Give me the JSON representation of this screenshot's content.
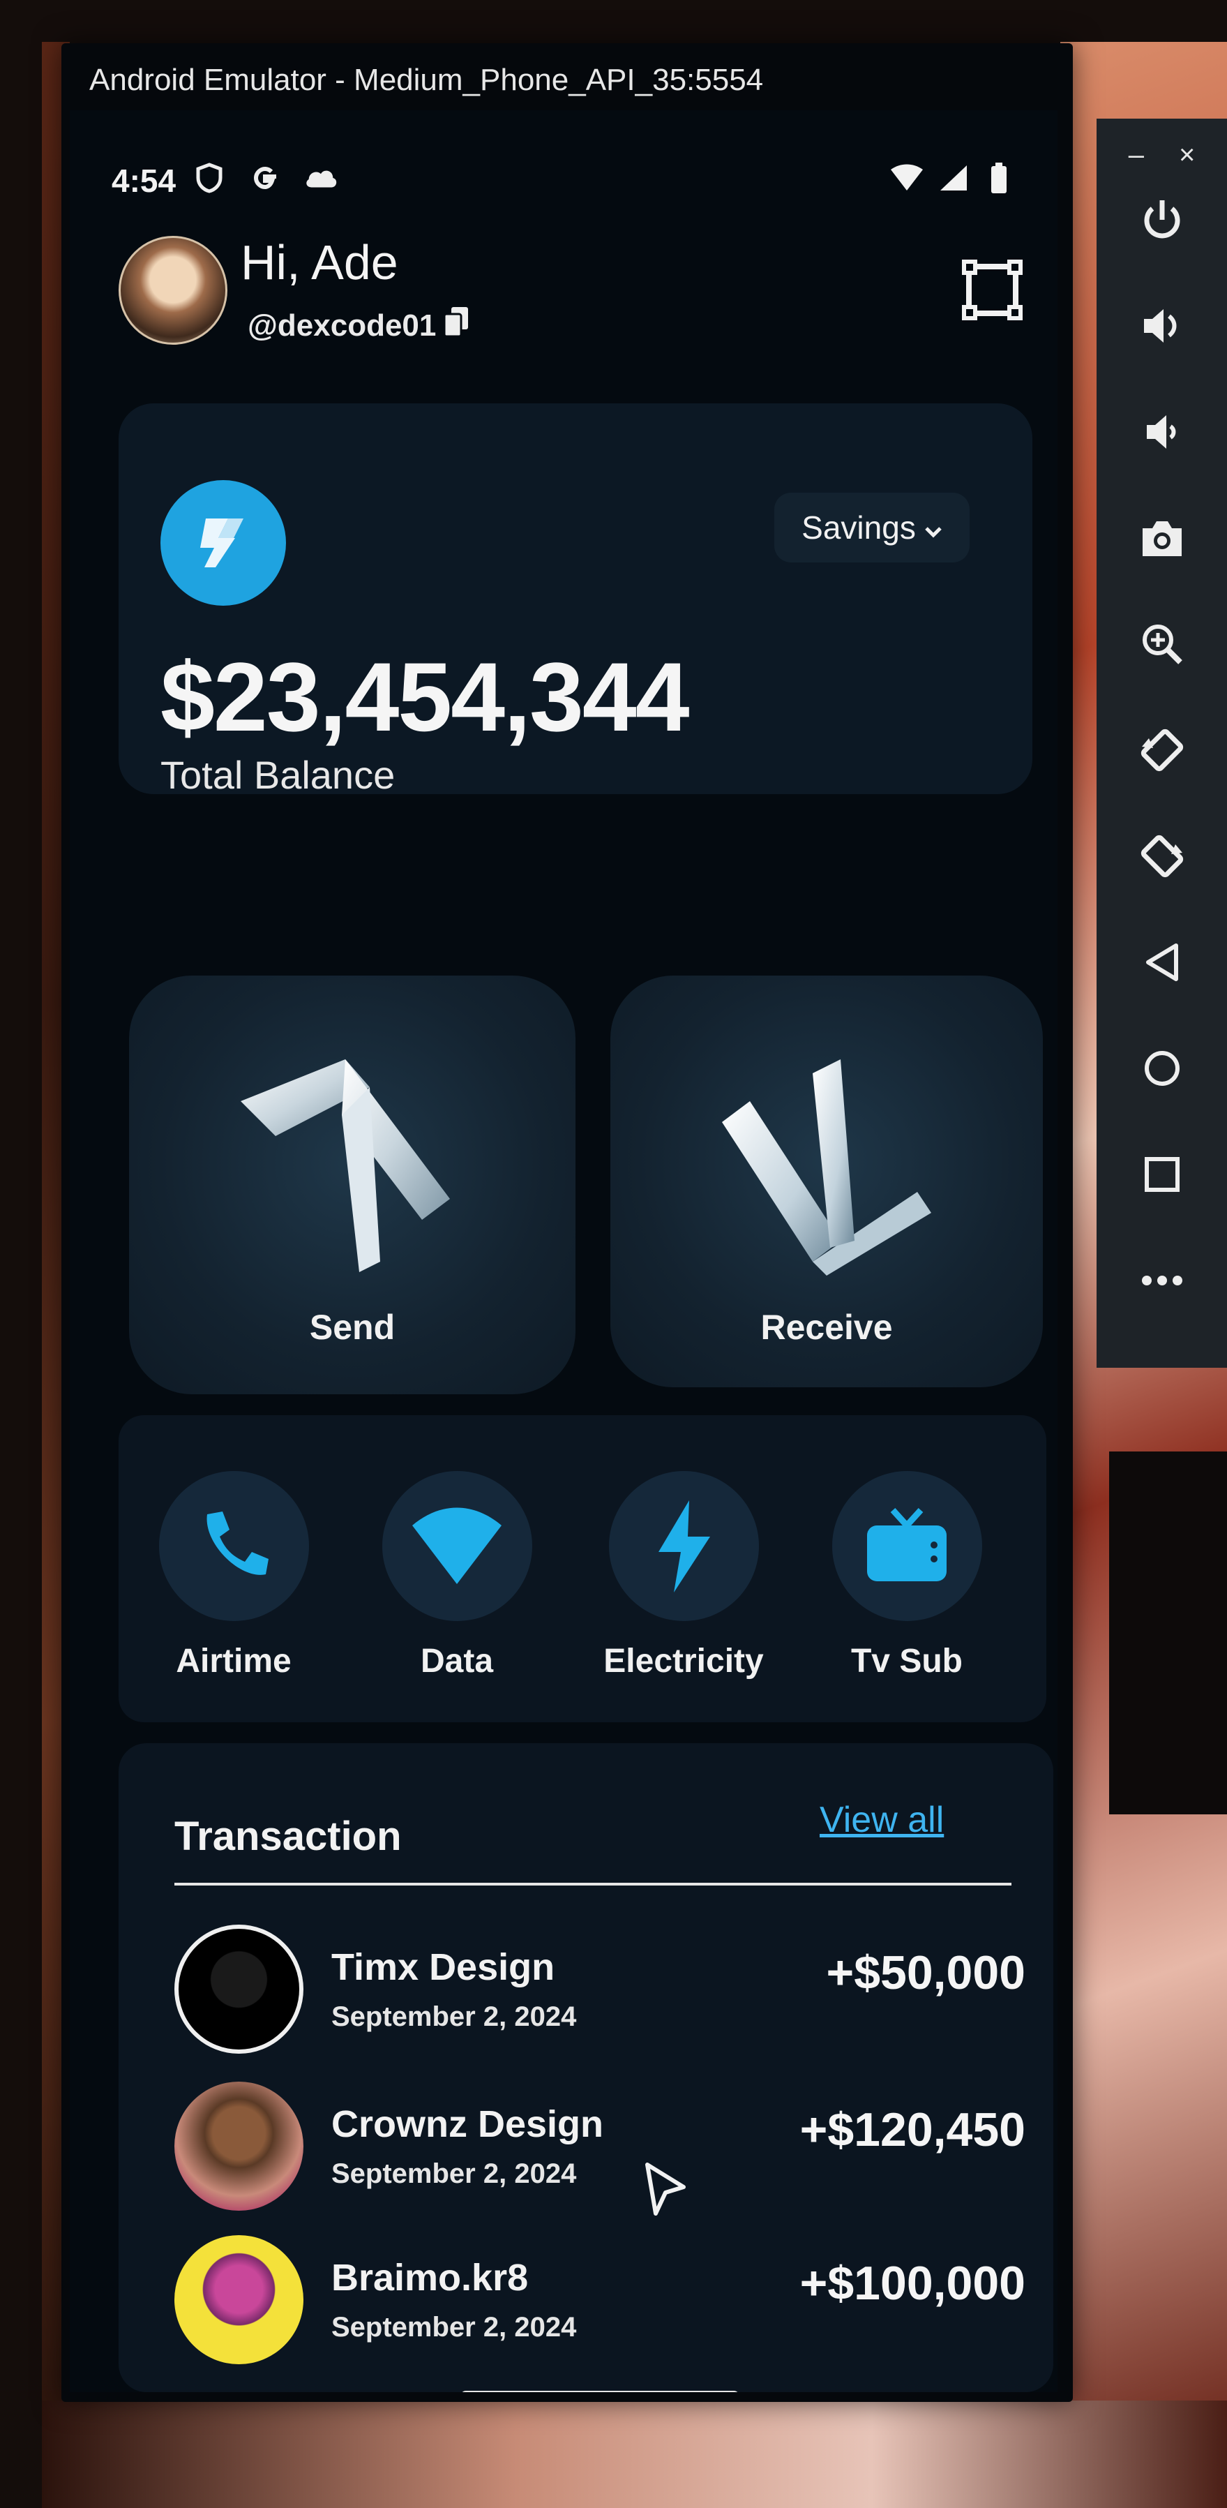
{
  "window": {
    "title": "Android Emulator - Medium_Phone_API_35:5554"
  },
  "status_bar": {
    "time": "4:54"
  },
  "header": {
    "greeting": "Hi, Ade",
    "handle": "@dexcode01"
  },
  "balance": {
    "account_type": "Savings",
    "amount": "$23,454,344",
    "label": "Total Balance"
  },
  "actions": {
    "send": "Send",
    "receive": "Receive"
  },
  "utilities": [
    {
      "label": "Airtime",
      "icon": "phone-icon"
    },
    {
      "label": "Data",
      "icon": "wifi-icon"
    },
    {
      "label": "Electricity",
      "icon": "lightning-icon"
    },
    {
      "label": "Tv Sub",
      "icon": "tv-icon"
    }
  ],
  "transactions": {
    "title": "Transaction",
    "view_all": "View all",
    "items": [
      {
        "name": "Timx Design",
        "date": "September 2, 2024",
        "amount": "+$50,000"
      },
      {
        "name": "Crownz Design",
        "date": "September 2, 2024",
        "amount": "+$120,450"
      },
      {
        "name": "Braimo.kr8",
        "date": "September 2, 2024",
        "amount": "+$100,000"
      }
    ]
  },
  "toolbar": {
    "minimize": "–",
    "close": "×",
    "buttons": [
      "power-icon",
      "volume-up-icon",
      "volume-down-icon",
      "camera-icon",
      "zoom-icon",
      "rotate-left-icon",
      "rotate-right-icon",
      "back-icon",
      "home-icon",
      "overview-icon",
      "more-icon"
    ]
  },
  "colors": {
    "accent": "#1fa3e0",
    "link": "#3fb4f0",
    "background": "#040a10",
    "card": "#0c1824"
  }
}
